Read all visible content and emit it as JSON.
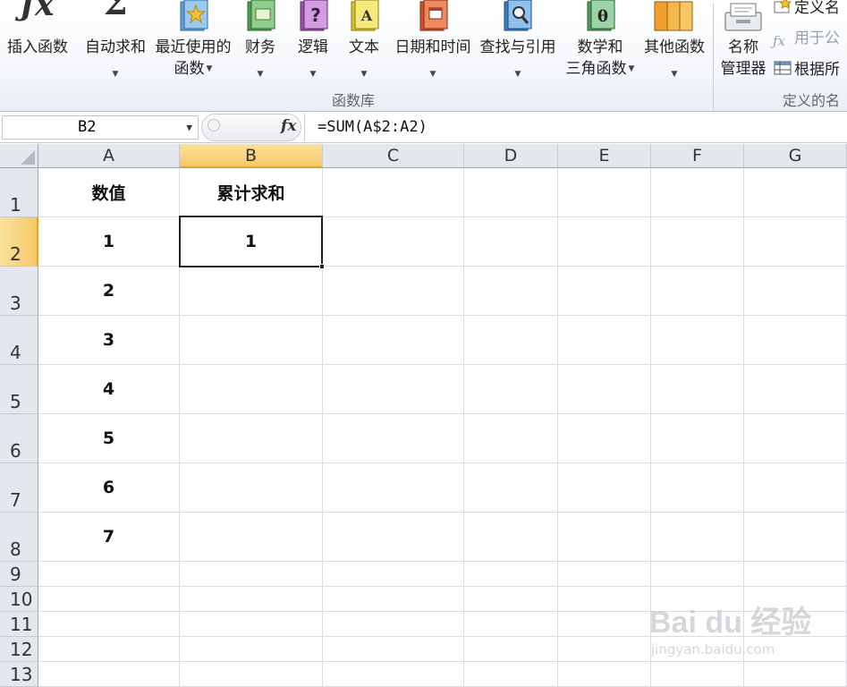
{
  "ribbon": {
    "buttons": [
      {
        "id": "insert-function",
        "label": "插入函数",
        "label2": "",
        "arrow": false
      },
      {
        "id": "autosum",
        "label": "自动求和",
        "label2": "",
        "arrow": true
      },
      {
        "id": "recently-used",
        "label": "最近使用的",
        "label2": "函数",
        "arrow": true
      },
      {
        "id": "financial",
        "label": "财务",
        "label2": "",
        "arrow": true
      },
      {
        "id": "logical",
        "label": "逻辑",
        "label2": "",
        "arrow": true
      },
      {
        "id": "text",
        "label": "文本",
        "label2": "",
        "arrow": true
      },
      {
        "id": "datetime",
        "label": "日期和时间",
        "label2": "",
        "arrow": true
      },
      {
        "id": "lookup",
        "label": "查找与引用",
        "label2": "",
        "arrow": true
      },
      {
        "id": "mathtrig",
        "label": "数学和",
        "label2": "三角函数",
        "arrow": true
      },
      {
        "id": "more",
        "label": "其他函数",
        "label2": "",
        "arrow": true
      },
      {
        "id": "name-manager",
        "label": "名称",
        "label2": "管理器",
        "arrow": false
      }
    ],
    "small_buttons": [
      {
        "id": "define-name",
        "label": "定义名",
        "disabled": false
      },
      {
        "id": "use-in-formula",
        "label": "用于公",
        "disabled": true
      },
      {
        "id": "create-from-selection",
        "label": "根据所",
        "disabled": false
      }
    ],
    "groups": {
      "function_library": "函数库",
      "defined_names": "定义的名"
    }
  },
  "formula_bar": {
    "name_box": "B2",
    "fx_symbol": "fx",
    "formula": "=SUM(A$2:A2)"
  },
  "sheet": {
    "columns": [
      "A",
      "B",
      "C",
      "D",
      "E",
      "F",
      "G"
    ],
    "selected_column": "B",
    "rows": [
      {
        "num": "1",
        "cells": [
          "数值",
          "累计求和",
          "",
          "",
          "",
          "",
          ""
        ]
      },
      {
        "num": "2",
        "cells": [
          "1",
          "1",
          "",
          "",
          "",
          "",
          ""
        ]
      },
      {
        "num": "3",
        "cells": [
          "2",
          "",
          "",
          "",
          "",
          "",
          ""
        ]
      },
      {
        "num": "4",
        "cells": [
          "3",
          "",
          "",
          "",
          "",
          "",
          ""
        ]
      },
      {
        "num": "5",
        "cells": [
          "4",
          "",
          "",
          "",
          "",
          "",
          ""
        ]
      },
      {
        "num": "6",
        "cells": [
          "5",
          "",
          "",
          "",
          "",
          "",
          ""
        ]
      },
      {
        "num": "7",
        "cells": [
          "6",
          "",
          "",
          "",
          "",
          "",
          ""
        ]
      },
      {
        "num": "8",
        "cells": [
          "7",
          "",
          "",
          "",
          "",
          "",
          ""
        ]
      },
      {
        "num": "9",
        "cells": [
          "",
          "",
          "",
          "",
          "",
          "",
          ""
        ]
      },
      {
        "num": "10",
        "cells": [
          "",
          "",
          "",
          "",
          "",
          "",
          ""
        ]
      },
      {
        "num": "11",
        "cells": [
          "",
          "",
          "",
          "",
          "",
          "",
          ""
        ]
      },
      {
        "num": "12",
        "cells": [
          "",
          "",
          "",
          "",
          "",
          "",
          ""
        ]
      },
      {
        "num": "13",
        "cells": [
          "",
          "",
          "",
          "",
          "",
          "",
          ""
        ]
      }
    ],
    "selected_row": "2",
    "active_cell": "B2"
  },
  "watermark": {
    "main": "Bai du 经验",
    "sub": "jingyan.baidu.com"
  },
  "colors": {
    "selection_header": "#f6c869",
    "header_bg": "#e4e8ee",
    "gridline": "#dadcdf"
  }
}
